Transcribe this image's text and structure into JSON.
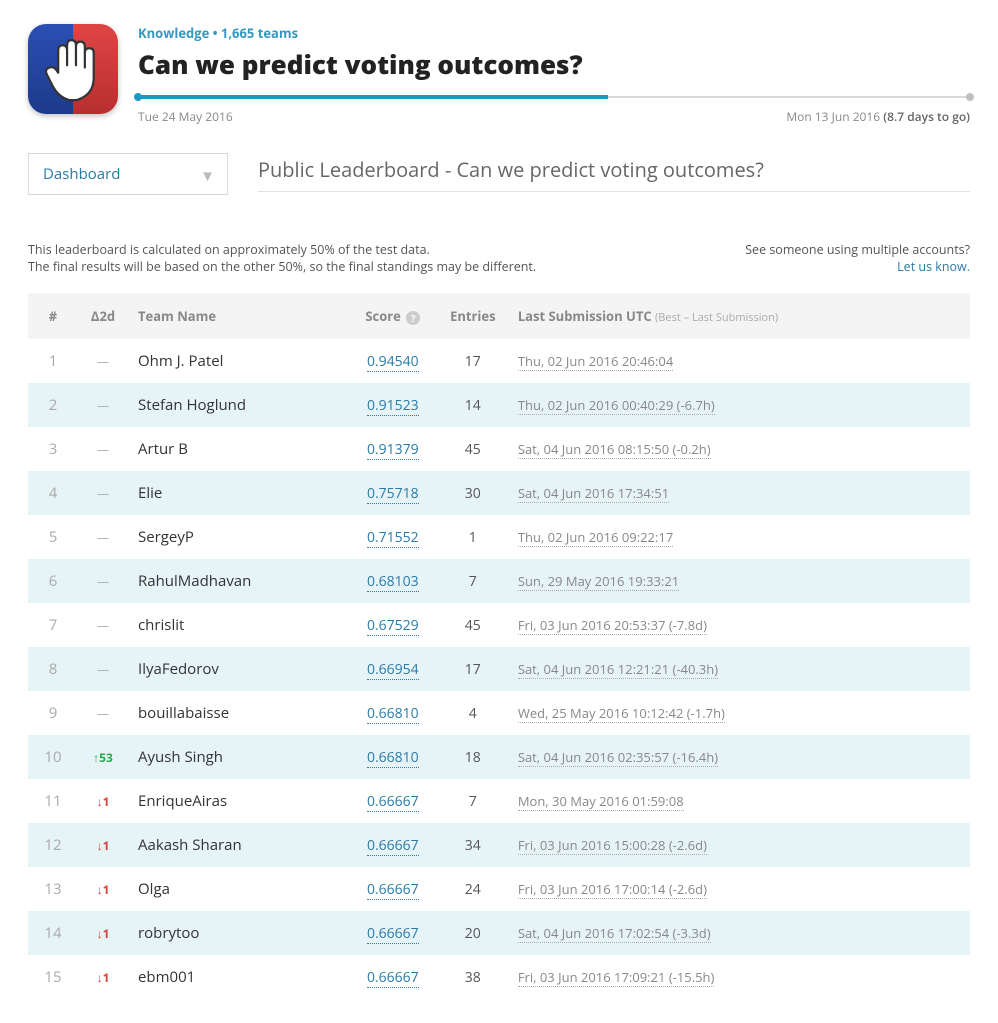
{
  "header": {
    "crumb": "Knowledge • 1,665 teams",
    "title": "Can we predict voting outcomes?",
    "start_date": "Tue 24 May 2016",
    "end_date": "Mon 13 Jun 2016",
    "remaining": "(8.7 days to go)"
  },
  "dropdown": {
    "label": "Dashboard"
  },
  "section_title": "Public Leaderboard - Can we predict voting outcomes?",
  "note_left_1": "This leaderboard is calculated on approximately 50% of the test data.",
  "note_left_2": "The final results will be based on the other 50%, so the final standings may be different.",
  "note_right_1": "See someone using multiple accounts?",
  "note_right_link": "Let us know.",
  "columns": {
    "rank": "#",
    "delta": "Δ2d",
    "team": "Team Name",
    "score": "Score",
    "entries": "Entries",
    "last": "Last Submission UTC",
    "last_sub": "(Best – Last Submission)"
  },
  "rows": [
    {
      "rank": 1,
      "delta_dir": "none",
      "delta_val": "—",
      "team": "Ohm J. Patel",
      "score": "0.94540",
      "entries": 17,
      "last": "Thu, 02 Jun 2016 20:46:04"
    },
    {
      "rank": 2,
      "delta_dir": "none",
      "delta_val": "—",
      "team": "Stefan Hoglund",
      "score": "0.91523",
      "entries": 14,
      "last": "Thu, 02 Jun 2016 00:40:29 (-6.7h)"
    },
    {
      "rank": 3,
      "delta_dir": "none",
      "delta_val": "—",
      "team": "Artur B",
      "score": "0.91379",
      "entries": 45,
      "last": "Sat, 04 Jun 2016 08:15:50 (-0.2h)"
    },
    {
      "rank": 4,
      "delta_dir": "none",
      "delta_val": "—",
      "team": "Elie",
      "score": "0.75718",
      "entries": 30,
      "last": "Sat, 04 Jun 2016 17:34:51"
    },
    {
      "rank": 5,
      "delta_dir": "none",
      "delta_val": "—",
      "team": "SergeyP",
      "score": "0.71552",
      "entries": 1,
      "last": "Thu, 02 Jun 2016 09:22:17"
    },
    {
      "rank": 6,
      "delta_dir": "none",
      "delta_val": "—",
      "team": "RahulMadhavan",
      "score": "0.68103",
      "entries": 7,
      "last": "Sun, 29 May 2016 19:33:21"
    },
    {
      "rank": 7,
      "delta_dir": "none",
      "delta_val": "—",
      "team": "chrislit",
      "score": "0.67529",
      "entries": 45,
      "last": "Fri, 03 Jun 2016 20:53:37 (-7.8d)"
    },
    {
      "rank": 8,
      "delta_dir": "none",
      "delta_val": "—",
      "team": "IlyaFedorov",
      "score": "0.66954",
      "entries": 17,
      "last": "Sat, 04 Jun 2016 12:21:21 (-40.3h)"
    },
    {
      "rank": 9,
      "delta_dir": "none",
      "delta_val": "—",
      "team": "bouillabaisse",
      "score": "0.66810",
      "entries": 4,
      "last": "Wed, 25 May 2016 10:12:42 (-1.7h)"
    },
    {
      "rank": 10,
      "delta_dir": "up",
      "delta_val": "53",
      "team": "Ayush Singh",
      "score": "0.66810",
      "entries": 18,
      "last": "Sat, 04 Jun 2016 02:35:57 (-16.4h)"
    },
    {
      "rank": 11,
      "delta_dir": "down",
      "delta_val": "1",
      "team": "EnriqueAiras",
      "score": "0.66667",
      "entries": 7,
      "last": "Mon, 30 May 2016 01:59:08"
    },
    {
      "rank": 12,
      "delta_dir": "down",
      "delta_val": "1",
      "team": "Aakash Sharan",
      "score": "0.66667",
      "entries": 34,
      "last": "Fri, 03 Jun 2016 15:00:28 (-2.6d)"
    },
    {
      "rank": 13,
      "delta_dir": "down",
      "delta_val": "1",
      "team": "Olga",
      "score": "0.66667",
      "entries": 24,
      "last": "Fri, 03 Jun 2016 17:00:14 (-2.6d)"
    },
    {
      "rank": 14,
      "delta_dir": "down",
      "delta_val": "1",
      "team": "robrytoo",
      "score": "0.66667",
      "entries": 20,
      "last": "Sat, 04 Jun 2016 17:02:54 (-3.3d)"
    },
    {
      "rank": 15,
      "delta_dir": "down",
      "delta_val": "1",
      "team": "ebm001",
      "score": "0.66667",
      "entries": 38,
      "last": "Fri, 03 Jun 2016 17:09:21 (-15.5h)"
    }
  ]
}
